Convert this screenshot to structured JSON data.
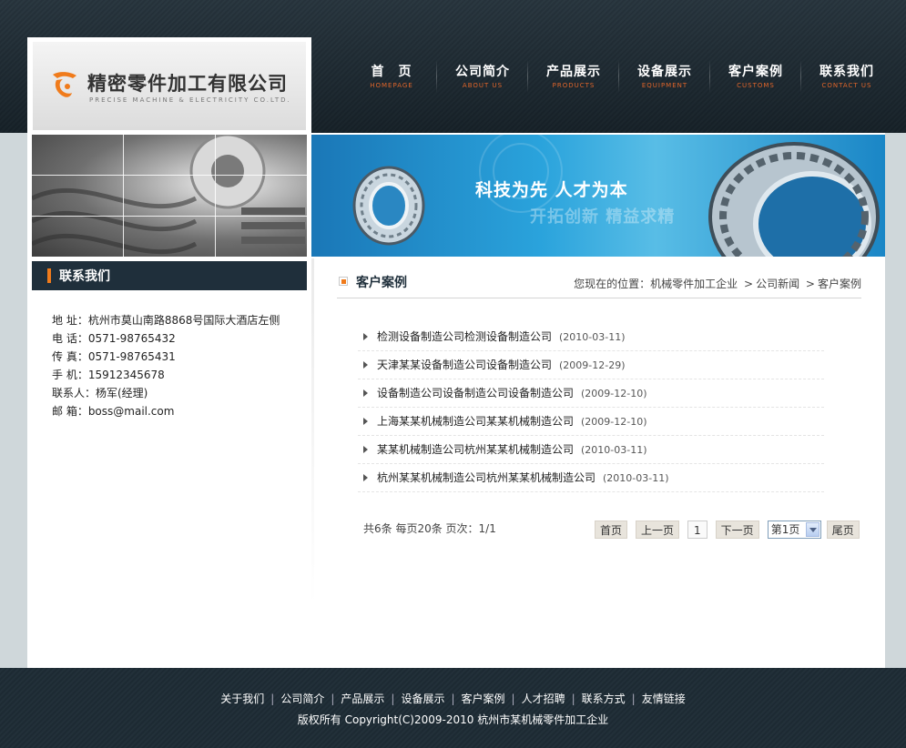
{
  "header": {
    "company_cn": "精密零件加工有限公司",
    "company_en": "PRECISE MACHINE & ELECTRICITY CO.LTD.",
    "nav": [
      {
        "cn": "首　页",
        "en": "HOMEPAGE"
      },
      {
        "cn": "公司简介",
        "en": "ABOUT US"
      },
      {
        "cn": "产品展示",
        "en": "PRODUCTS"
      },
      {
        "cn": "设备展示",
        "en": "EQUIPMENT"
      },
      {
        "cn": "客户案例",
        "en": "CUSTOMS"
      },
      {
        "cn": "联系我们",
        "en": "CONTACT US"
      }
    ]
  },
  "banner": {
    "slogan1": "科技为先 人才为本",
    "slogan2": "开拓创新 精益求精"
  },
  "sidebar": {
    "contact_title": "联系我们",
    "contact_lines": [
      "地  址：杭州市莫山南路8868号国际大酒店左侧",
      "电  话：0571-98765432",
      "传  真：0571-98765431",
      "手  机：15912345678",
      "联系人：杨军(经理)",
      "邮  箱：boss@mail.com"
    ]
  },
  "main": {
    "title": "客户案例",
    "breadcrumb": {
      "prefix": "您现在的位置：",
      "items": [
        "机械零件加工企业",
        "公司新闻",
        "客户案例"
      ],
      "sep": ">"
    },
    "cases": [
      {
        "title": "检测设备制造公司检测设备制造公司",
        "date": "(2010-03-11)"
      },
      {
        "title": "天津某某设备制造公司设备制造公司",
        "date": "(2009-12-29)"
      },
      {
        "title": "设备制造公司设备制造公司设备制造公司",
        "date": "(2009-12-10)"
      },
      {
        "title": "上海某某机械制造公司某某机械制造公司",
        "date": "(2009-12-10)"
      },
      {
        "title": "某某机械制造公司杭州某某机械制造公司",
        "date": "(2010-03-11)"
      },
      {
        "title": "杭州某某机械制造公司杭州某某机械制造公司",
        "date": "(2010-03-11)"
      }
    ],
    "pager": {
      "info": "共6条  每页20条  页次：1/1",
      "first": "首页",
      "prev": "上一页",
      "current": "1",
      "next": "下一页",
      "select_value": "第1页",
      "last": "尾页"
    }
  },
  "footer": {
    "links": [
      "关于我们",
      "公司简介",
      "产品展示",
      "设备展示",
      "客户案例",
      "人才招聘",
      "联系方式",
      "友情链接"
    ],
    "link_sep": "|",
    "copyright": "版权所有  Copyright(C)2009-2010 杭州市某机械零件加工企业"
  },
  "colors": {
    "accent": "#f07b1b",
    "header_bg": "#1f2c35",
    "banner_blue": "#2aa3dc"
  }
}
